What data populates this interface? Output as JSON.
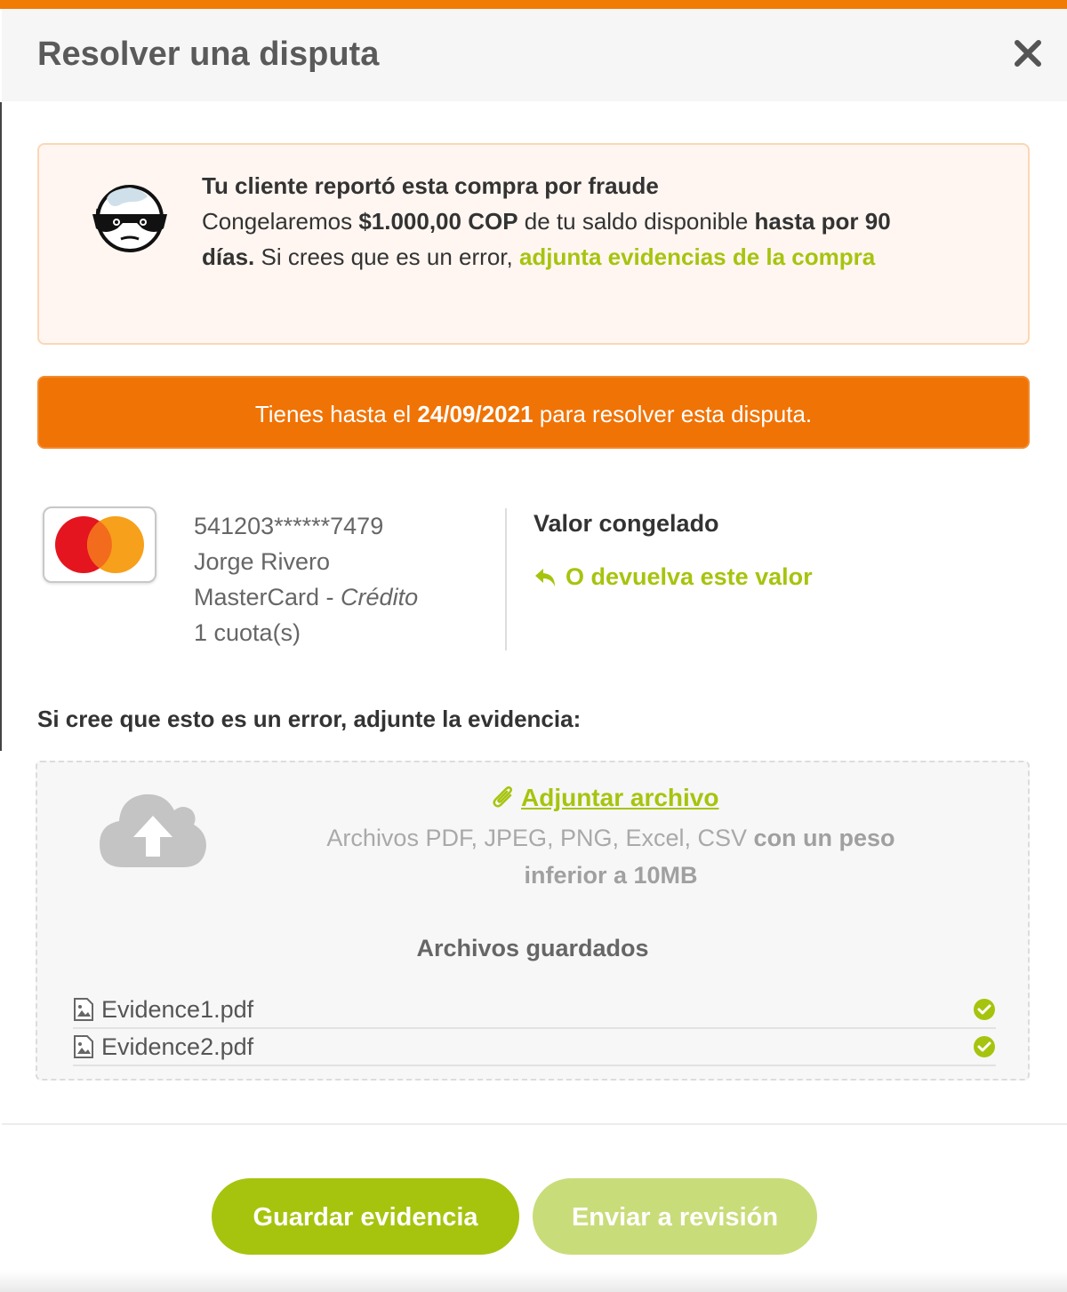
{
  "modal": {
    "title": "Resolver una disputa"
  },
  "alert": {
    "headline": "Tu cliente reportó esta compra por fraude",
    "text_1": "Congelaremos ",
    "amount": "$1.000,00 COP",
    "text_2": " de tu saldo disponible ",
    "period": "hasta por 90 días.",
    "text_3": " Si crees que es un error, ",
    "link": "adjunta evidencias de la compra"
  },
  "deadline": {
    "prefix": "Tienes hasta el ",
    "date": "24/09/2021",
    "suffix": " para resolver esta disputa."
  },
  "card": {
    "number": "541203******7479",
    "holder": "Jorge Rivero",
    "brand": "MasterCard",
    "separator": " - ",
    "type": "Crédito",
    "installments": "1 cuota(s)"
  },
  "value": {
    "label": "Valor congelado",
    "refund_link": "O devuelva este valor"
  },
  "evidence": {
    "heading": "Si cree que esto es un error, adjunte la evidencia:",
    "attach_link": "Adjuntar archivo",
    "hint_plain": "Archivos PDF, JPEG, PNG, Excel, CSV ",
    "hint_bold": "con un peso inferior a 10MB",
    "saved_title": "Archivos guardados",
    "files": [
      {
        "name": "Evidence1.pdf"
      },
      {
        "name": "Evidence2.pdf"
      }
    ]
  },
  "footer": {
    "save_label": "Guardar evidencia",
    "send_label": "Enviar a revisión"
  },
  "colors": {
    "accent_orange": "#f07305",
    "accent_green": "#a6c40e",
    "disabled_green": "#c9dc7a"
  },
  "icons": [
    "close-icon",
    "thief-icon",
    "mastercard-logo",
    "reply-arrow-icon",
    "cloud-upload-icon",
    "paperclip-icon",
    "image-file-icon",
    "check-circle-icon"
  ]
}
